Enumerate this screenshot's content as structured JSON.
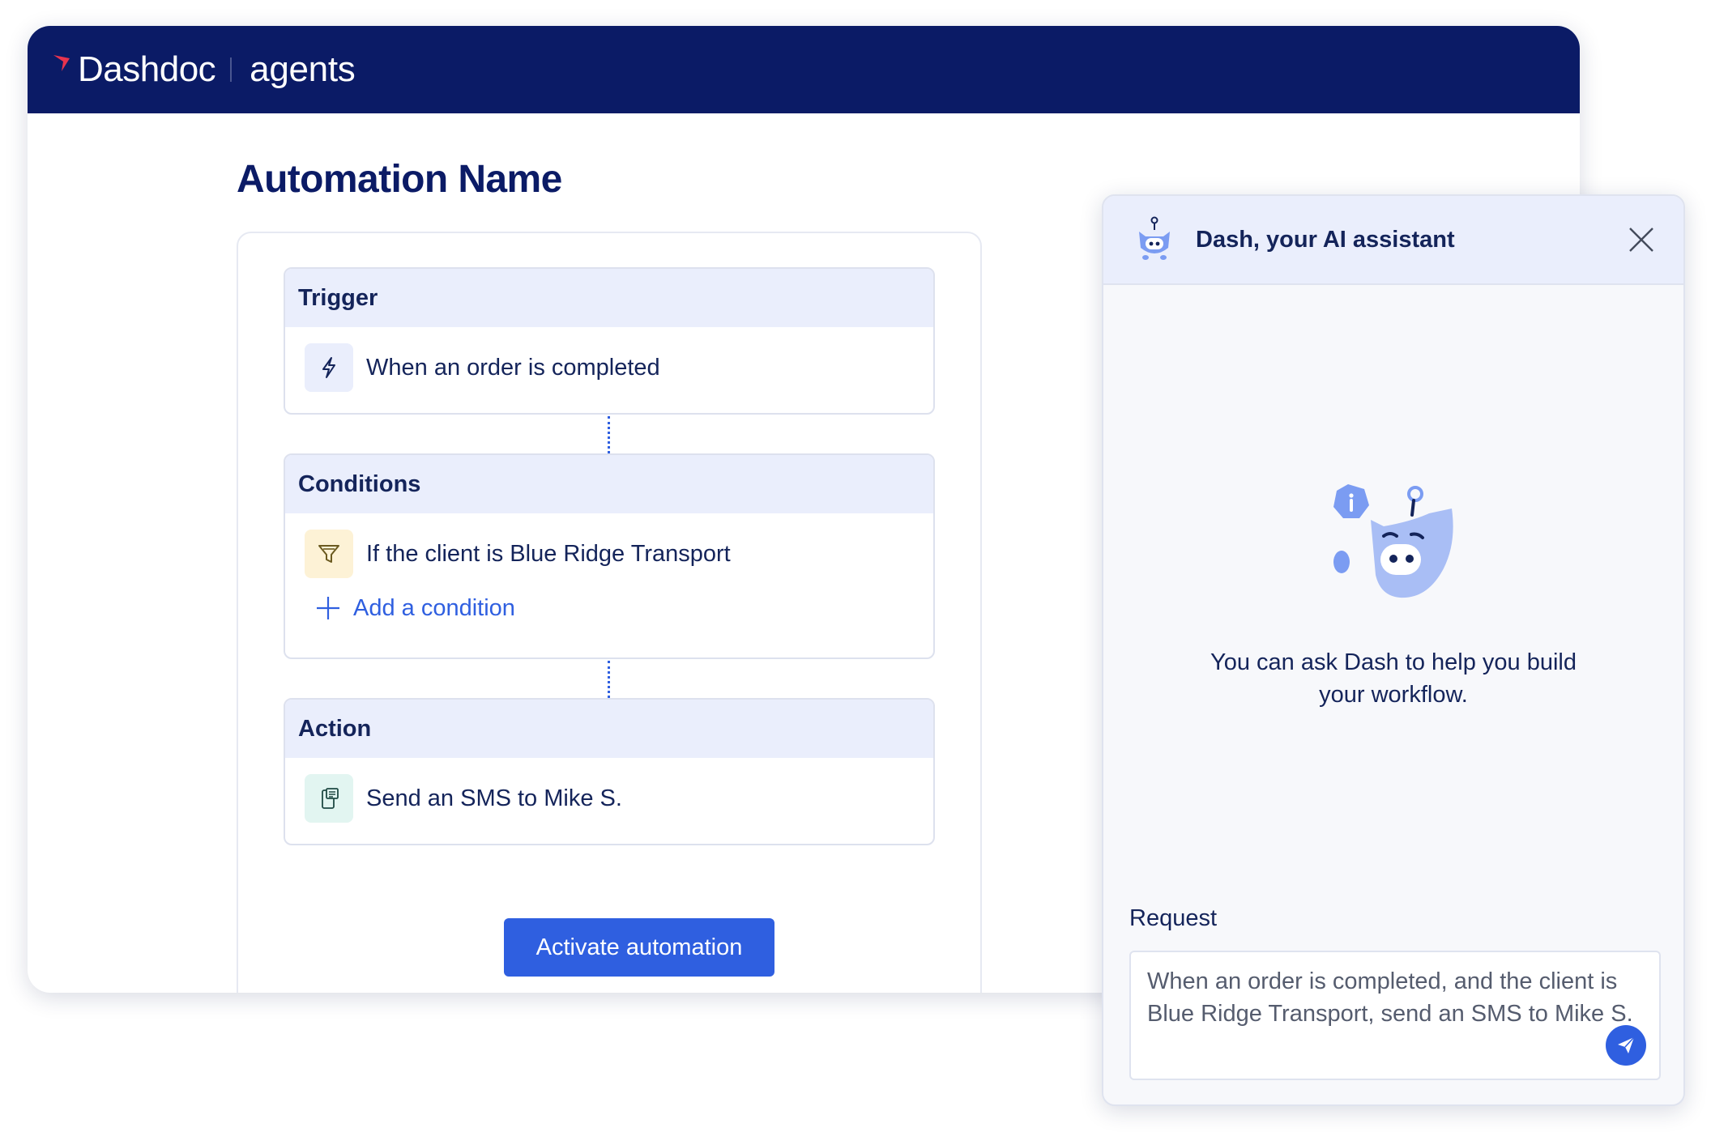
{
  "app": {
    "brand": "Dashdoc",
    "product": "agents"
  },
  "page": {
    "title": "Automation Name"
  },
  "builder": {
    "trigger": {
      "heading": "Trigger",
      "icon": "lightning-icon",
      "text": "When an order is completed"
    },
    "conditions": {
      "heading": "Conditions",
      "icon": "filter-icon",
      "text": "If the client is Blue Ridge Transport",
      "add_label": "Add a condition"
    },
    "action": {
      "heading": "Action",
      "icon": "sms-icon",
      "text": "Send an SMS to Mike S."
    },
    "activate_label": "Activate automation"
  },
  "assistant": {
    "title": "Dash, your AI assistant",
    "empty_line1": "You can ask Dash to help you build",
    "empty_line2": "your workflow.",
    "request_label": "Request",
    "request_value": "When an order is completed, and the client is Blue Ridge Transport, send an SMS to Mike S."
  },
  "colors": {
    "navy": "#0b1b66",
    "accent": "#2f5fe0",
    "logo_red": "#e8344e",
    "step_header": "#eaeefc",
    "filter_bg": "#fdf2d6",
    "sms_bg": "#e2f5f1"
  }
}
